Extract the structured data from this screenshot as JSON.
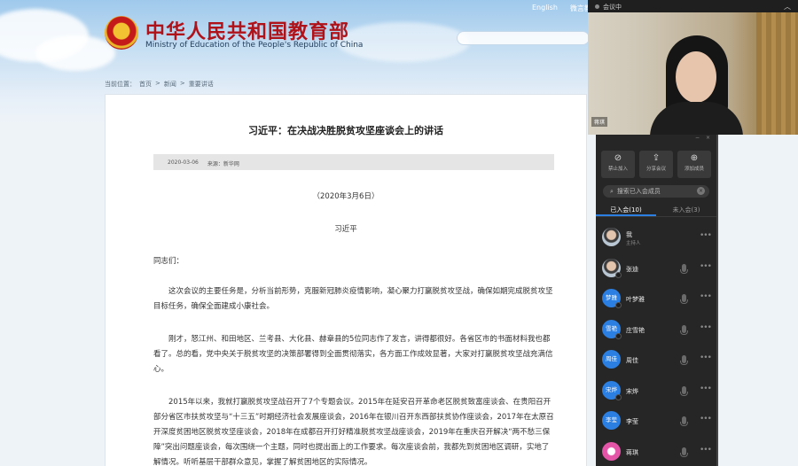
{
  "site": {
    "top_links": [
      "English",
      "微言教育"
    ],
    "title": "中华人民共和国教育部",
    "subtitle": "Ministry of Education of the People's Republic of China",
    "breadcrumb": [
      "当前位置：",
      "首页",
      ">",
      "新闻",
      ">",
      "重要讲话"
    ]
  },
  "article": {
    "title": "习近平：在决战决胜脱贫攻坚座谈会上的讲话",
    "meta_date": "2020-03-06",
    "meta_source": "来源：新华网",
    "date_line": "（2020年3月6日）",
    "author": "习近平",
    "paragraphs": [
      "同志们：",
      "这次会议的主要任务是，分析当前形势，克服新冠肺炎疫情影响，凝心聚力打赢脱贫攻坚战，确保如期完成脱贫攻坚目标任务，确保全面建成小康社会。",
      "刚才，怒江州、和田地区、兰考县、大化县、赫章县的5位同志作了发言，讲得都很好。各省区市的书面材料我也都看了。总的看，党中央关于脱贫攻坚的决策部署得到全面贯彻落实，各方面工作成效显著，大家对打赢脱贫攻坚战充满信心。",
      "2015年以来，我就打赢脱贫攻坚战召开了7个专题会议。2015年在延安召开革命老区脱贫致富座谈会、在贵阳召开部分省区市扶贫攻坚与“十三五”时期经济社会发展座谈会，2016年在银川召开东西部扶贫协作座谈会，2017年在太原召开深度贫困地区脱贫攻坚座谈会，2018年在成都召开打好精准脱贫攻坚战座谈会，2019年在重庆召开解决“两不愁三保障”突出问题座谈会，每次围绕一个主题，同时也提出面上的工作要求。每次座谈会前，我都先到贫困地区调研，实地了解情况。听听基层干部群众意见，掌握了解贫困地区的实际情况。"
    ]
  },
  "video": {
    "title": "会议中",
    "name_tag": "蒋琪"
  },
  "members_panel": {
    "actions": [
      {
        "icon": "phone-mute-icon",
        "glyph": "⊘",
        "label": "禁止加入"
      },
      {
        "icon": "share-icon",
        "glyph": "⇪",
        "label": "分享会议"
      },
      {
        "icon": "add-user-icon",
        "glyph": "⊕",
        "label": "添加成员"
      }
    ],
    "search_placeholder": "搜索已入会成员",
    "tabs": [
      {
        "label": "已入会(10)",
        "active": true
      },
      {
        "label": "未入会(3)",
        "active": false
      }
    ],
    "members": [
      {
        "name": "我",
        "role": "主持人",
        "avatar_text": "",
        "avatar_style": "photo",
        "mic": false
      },
      {
        "name": "张迪",
        "role": "",
        "avatar_text": "",
        "avatar_style": "photo",
        "mic": true
      },
      {
        "name": "叶梦雅",
        "role": "",
        "avatar_text": "梦雅",
        "avatar_style": "blue",
        "mic": true
      },
      {
        "name": "庄雪艳",
        "role": "",
        "avatar_text": "雪艳",
        "avatar_style": "blue",
        "mic": true
      },
      {
        "name": "周佳",
        "role": "",
        "avatar_text": "周佳",
        "avatar_style": "blue",
        "mic": true
      },
      {
        "name": "宋烨",
        "role": "",
        "avatar_text": "宋烨",
        "avatar_style": "blue",
        "mic": true
      },
      {
        "name": "李莹",
        "role": "",
        "avatar_text": "李莹",
        "avatar_style": "blue",
        "mic": true
      },
      {
        "name": "蒋琪",
        "role": "",
        "avatar_text": "",
        "avatar_style": "pink",
        "mic": true
      }
    ],
    "more_glyph": "•••",
    "clear_glyph": "×"
  },
  "colors": {
    "accent": "#2b7fe3",
    "site_title": "#b0121a",
    "panel_bg": "#262626"
  }
}
